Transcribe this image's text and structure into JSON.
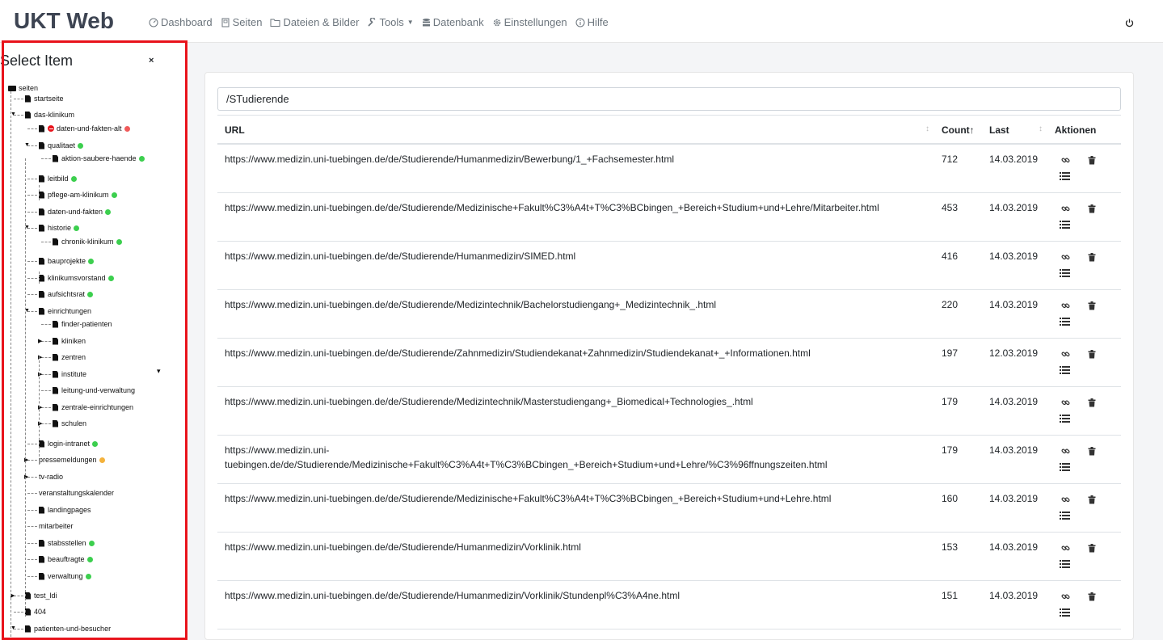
{
  "app": {
    "title": "UKT Web",
    "nav": [
      {
        "label": "Dashboard",
        "icon": "dashboard-icon"
      },
      {
        "label": "Seiten",
        "icon": "pages-icon"
      },
      {
        "label": "Dateien & Bilder",
        "icon": "folder-icon"
      },
      {
        "label": "Tools",
        "icon": "wrench-icon"
      },
      {
        "label": "Datenbank",
        "icon": "database-icon"
      },
      {
        "label": "Einstellungen",
        "icon": "gear-icon"
      },
      {
        "label": "Hilfe",
        "icon": "info-icon"
      }
    ]
  },
  "sidebar": {
    "title": "Select Item",
    "close": "×",
    "tree": [
      {
        "label": "seiten",
        "level": 0,
        "type": "folder",
        "status": ""
      },
      {
        "label": "startseite",
        "level": 1,
        "type": "doc",
        "status": ""
      },
      {
        "label": "das-klinikum",
        "level": 1,
        "type": "doc",
        "status": "",
        "expanded": true
      },
      {
        "label": "daten-und-fakten-alt",
        "level": 2,
        "type": "doc",
        "status": "red",
        "blocked": true
      },
      {
        "label": "qualitaet",
        "level": 2,
        "type": "doc",
        "status": "green",
        "expanded": true
      },
      {
        "label": "aktion-saubere-haende",
        "level": 3,
        "type": "doc",
        "status": "green"
      },
      {
        "label": "leitbild",
        "level": 2,
        "type": "doc",
        "status": "green"
      },
      {
        "label": "pflege-am-klinikum",
        "level": 2,
        "type": "doc",
        "status": "green"
      },
      {
        "label": "daten-und-fakten",
        "level": 2,
        "type": "doc",
        "status": "green"
      },
      {
        "label": "historie",
        "level": 2,
        "type": "doc",
        "status": "green",
        "expanded": true
      },
      {
        "label": "chronik-klinikum",
        "level": 3,
        "type": "doc",
        "status": "green"
      },
      {
        "label": "bauprojekte",
        "level": 2,
        "type": "doc",
        "status": "green"
      },
      {
        "label": "klinikumsvorstand",
        "level": 2,
        "type": "doc",
        "status": "green"
      },
      {
        "label": "aufsichtsrat",
        "level": 2,
        "type": "doc",
        "status": "green"
      },
      {
        "label": "einrichtungen",
        "level": 2,
        "type": "doc",
        "status": "",
        "expanded": true
      },
      {
        "label": "finder-patienten",
        "level": 3,
        "type": "doc",
        "status": ""
      },
      {
        "label": "kliniken",
        "level": 3,
        "type": "doc",
        "status": "",
        "collapsed": true
      },
      {
        "label": "zentren",
        "level": 3,
        "type": "doc",
        "status": "",
        "collapsed": true
      },
      {
        "label": "institute",
        "level": 3,
        "type": "doc",
        "status": "",
        "collapsed": true
      },
      {
        "label": "leitung-und-verwaltung",
        "level": 3,
        "type": "doc",
        "status": ""
      },
      {
        "label": "zentrale-einrichtungen",
        "level": 3,
        "type": "doc",
        "status": "",
        "collapsed": true
      },
      {
        "label": "schulen",
        "level": 3,
        "type": "doc",
        "status": "",
        "collapsed": true
      },
      {
        "label": "login-intranet",
        "level": 2,
        "type": "doc",
        "status": "green"
      },
      {
        "label": "pressemeldungen",
        "level": 2,
        "type": "none",
        "status": "orange",
        "collapsed": true
      },
      {
        "label": "tv-radio",
        "level": 2,
        "type": "none",
        "status": "",
        "collapsed": true
      },
      {
        "label": "veranstaltungskalender",
        "level": 2,
        "type": "none",
        "status": ""
      },
      {
        "label": "landingpages",
        "level": 2,
        "type": "doc",
        "status": ""
      },
      {
        "label": "mitarbeiter",
        "level": 2,
        "type": "none",
        "status": ""
      },
      {
        "label": "stabsstellen",
        "level": 2,
        "type": "doc",
        "status": "green"
      },
      {
        "label": "beauftragte",
        "level": 2,
        "type": "doc",
        "status": "green"
      },
      {
        "label": "verwaltung",
        "level": 2,
        "type": "doc",
        "status": "green"
      },
      {
        "label": "test_ldi",
        "level": 1,
        "type": "doc",
        "status": "",
        "collapsed": true
      },
      {
        "label": "404",
        "level": 1,
        "type": "doc",
        "status": ""
      },
      {
        "label": "patienten-und-besucher",
        "level": 1,
        "type": "doc",
        "status": "",
        "expanded": true
      }
    ]
  },
  "filter": {
    "value": "/STudierende"
  },
  "table": {
    "headers": {
      "url": "URL",
      "count": "Count",
      "last": "Last",
      "actions": "Aktionen"
    },
    "rows": [
      {
        "url": "https://www.medizin.uni-tuebingen.de/de/Studierende/Humanmedizin/Bewerbung/1_+Fachsemester.html",
        "count": "712",
        "last": "14.03.2019"
      },
      {
        "url": "https://www.medizin.uni-tuebingen.de/de/Studierende/Medizinische+Fakult%C3%A4t+T%C3%BCbingen_+Bereich+Studium+und+Lehre/Mitarbeiter.html",
        "count": "453",
        "last": "14.03.2019"
      },
      {
        "url": "https://www.medizin.uni-tuebingen.de/de/Studierende/Humanmedizin/SIMED.html",
        "count": "416",
        "last": "14.03.2019"
      },
      {
        "url": "https://www.medizin.uni-tuebingen.de/de/Studierende/Medizintechnik/Bachelorstudiengang+_Medizintechnik_.html",
        "count": "220",
        "last": "14.03.2019"
      },
      {
        "url": "https://www.medizin.uni-tuebingen.de/de/Studierende/Zahnmedizin/Studiendekanat+Zahnmedizin/Studiendekanat+_+Informationen.html",
        "count": "197",
        "last": "12.03.2019"
      },
      {
        "url": "https://www.medizin.uni-tuebingen.de/de/Studierende/Medizintechnik/Masterstudiengang+_Biomedical+Technologies_.html",
        "count": "179",
        "last": "14.03.2019"
      },
      {
        "url": "https://www.medizin.uni-tuebingen.de/de/Studierende/Medizinische+Fakult%C3%A4t+T%C3%BCbingen_+Bereich+Studium+und+Lehre/%C3%96ffnungszeiten.html",
        "count": "179",
        "last": "14.03.2019",
        "wrap": [
          "https://www.medizin.uni-",
          "tuebingen.de/de/Studierende/Medizinische+Fakult%C3%A4t+T%C3%BCbingen_+Bereich+Studium+und+Lehre/%C3%96ffnungszeiten.html"
        ]
      },
      {
        "url": "https://www.medizin.uni-tuebingen.de/de/Studierende/Medizinische+Fakult%C3%A4t+T%C3%BCbingen_+Bereich+Studium+und+Lehre.html",
        "count": "160",
        "last": "14.03.2019"
      },
      {
        "url": "https://www.medizin.uni-tuebingen.de/de/Studierende/Humanmedizin/Vorklinik.html",
        "count": "153",
        "last": "14.03.2019"
      },
      {
        "url": "https://www.medizin.uni-tuebingen.de/de/Studierende/Humanmedizin/Vorklinik/Stundenpl%C3%A4ne.html",
        "count": "151",
        "last": "14.03.2019"
      }
    ]
  }
}
